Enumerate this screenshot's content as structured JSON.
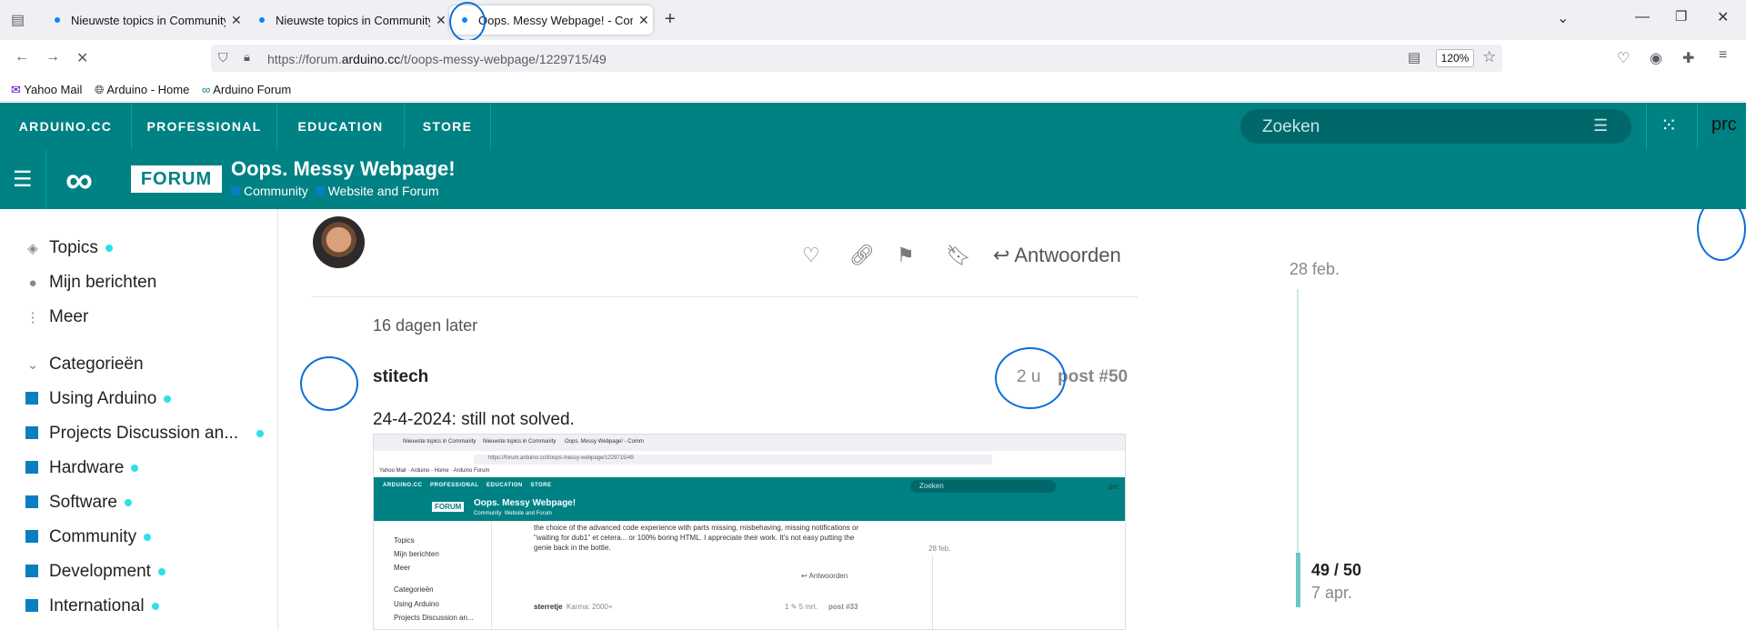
{
  "browser": {
    "tabs": [
      {
        "title": "Nieuwste topics in Community"
      },
      {
        "title": "Nieuwste topics in Community"
      },
      {
        "title": "Oops. Messy Webpage! - Comm"
      }
    ],
    "url_prefix": "https://forum.",
    "url_domain": "arduino.cc",
    "url_path": "/t/oops-messy-webpage/1229715/49",
    "zoom": "120%",
    "bookmarks": [
      "Yahoo Mail",
      "Arduino - Home",
      "Arduino Forum"
    ]
  },
  "topnav": {
    "items": [
      "ARDUINO.CC",
      "PROFESSIONAL",
      "EDUCATION",
      "STORE"
    ],
    "search_placeholder": "Zoeken",
    "user": "prc"
  },
  "header": {
    "logo_text": "FORUM",
    "title": "Oops. Messy Webpage!",
    "crumb1": "Community",
    "crumb2": "Website and Forum"
  },
  "sidebar": {
    "topics": "Topics",
    "my_posts": "Mijn berichten",
    "more": "Meer",
    "categories_label": "Categorieën",
    "categories": [
      "Using Arduino",
      "Projects Discussion an...",
      "Hardware",
      "Software",
      "Community",
      "Development",
      "International"
    ]
  },
  "post": {
    "reply_label": "Antwoorden",
    "gap_text": "16 dagen later",
    "author": "stitech",
    "age": "2 u",
    "post_number": "post #50",
    "text": "24-4-2024: still not solved."
  },
  "embedded": {
    "post_text": "the choice of the advanced code experience with parts missing, misbehaving, missing notifications or \"waiting for dub1\" et cetera... or 100% boring HTML. I appreciate their work. It's not easy putting the genie back in the bottle.",
    "date": "28 feb.",
    "reply": "Antwoorden",
    "author": "sterretje",
    "karma": "Karma: 2000+",
    "meta": "1 ✎   5 mrt.",
    "post_number": "post #33"
  },
  "timeline": {
    "start_date": "28 feb.",
    "count": "49 / 50",
    "end_date": "7 apr."
  },
  "colors": {
    "brand": "#008184",
    "accent_dot": "#2ee0e8",
    "annotation": "#0b6fd6"
  }
}
